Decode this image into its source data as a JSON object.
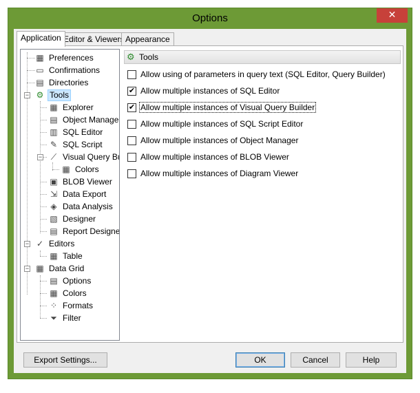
{
  "window": {
    "title": "Options",
    "close_glyph": "✕"
  },
  "tabs": [
    {
      "label": "Application"
    },
    {
      "label": "Editor & Viewers"
    },
    {
      "label": "Appearance"
    }
  ],
  "tree": {
    "items": [
      {
        "label": "Preferences",
        "icon": "preferences-icon",
        "glyph": "▦"
      },
      {
        "label": "Confirmations",
        "icon": "confirmations-icon",
        "glyph": "▭"
      },
      {
        "label": "Directories",
        "icon": "directories-icon",
        "glyph": "▤"
      },
      {
        "label": "Tools",
        "icon": "tools-icon",
        "glyph": "⚙",
        "expanded": true,
        "selected": true
      },
      {
        "label": "Explorer",
        "icon": "explorer-icon",
        "glyph": "▦"
      },
      {
        "label": "Object Manager",
        "icon": "object-manager-icon",
        "glyph": "▤"
      },
      {
        "label": "SQL Editor",
        "icon": "sql-editor-icon",
        "glyph": "▥"
      },
      {
        "label": "SQL Script",
        "icon": "sql-script-icon",
        "glyph": "✎"
      },
      {
        "label": "Visual Query Builder",
        "icon": "visual-query-builder-icon",
        "glyph": "⟋",
        "expanded": true
      },
      {
        "label": "Colors",
        "icon": "colors-icon",
        "glyph": "▦"
      },
      {
        "label": "BLOB Viewer",
        "icon": "blob-viewer-icon",
        "glyph": "▣"
      },
      {
        "label": "Data Export",
        "icon": "data-export-icon",
        "glyph": "⇲"
      },
      {
        "label": "Data Analysis",
        "icon": "data-analysis-icon",
        "glyph": "◈"
      },
      {
        "label": "Designer",
        "icon": "designer-icon",
        "glyph": "▧"
      },
      {
        "label": "Report Designer",
        "icon": "report-designer-icon",
        "glyph": "▤"
      },
      {
        "label": "Editors",
        "icon": "editors-icon",
        "glyph": "✓",
        "expanded": true
      },
      {
        "label": "Table",
        "icon": "table-icon",
        "glyph": "▦"
      },
      {
        "label": "Data Grid",
        "icon": "data-grid-icon",
        "glyph": "▦",
        "expanded": true
      },
      {
        "label": "Options",
        "icon": "options-icon",
        "glyph": "▤"
      },
      {
        "label": "Colors",
        "icon": "grid-colors-icon",
        "glyph": "▦"
      },
      {
        "label": "Formats",
        "icon": "formats-icon",
        "glyph": "⁘"
      },
      {
        "label": "Filter",
        "icon": "filter-icon",
        "glyph": "⏷"
      }
    ]
  },
  "content": {
    "header": {
      "label": "Tools",
      "icon": "tools-icon",
      "glyph": "⚙"
    },
    "options": [
      {
        "label": "Allow using of parameters in query text (SQL Editor, Query Builder)",
        "checked": false
      },
      {
        "label": "Allow multiple instances of SQL Editor",
        "checked": true
      },
      {
        "label": "Allow multiple instances of Visual Query Builder",
        "checked": true,
        "focused": true
      },
      {
        "label": "Allow multiple instances of SQL Script Editor",
        "checked": false
      },
      {
        "label": "Allow multiple instances of Object Manager",
        "checked": false
      },
      {
        "label": "Allow multiple instances of BLOB Viewer",
        "checked": false
      },
      {
        "label": "Allow multiple instances of Diagram Viewer",
        "checked": false
      }
    ]
  },
  "buttons": {
    "export": "Export Settings...",
    "ok": "OK",
    "cancel": "Cancel",
    "help": "Help"
  }
}
